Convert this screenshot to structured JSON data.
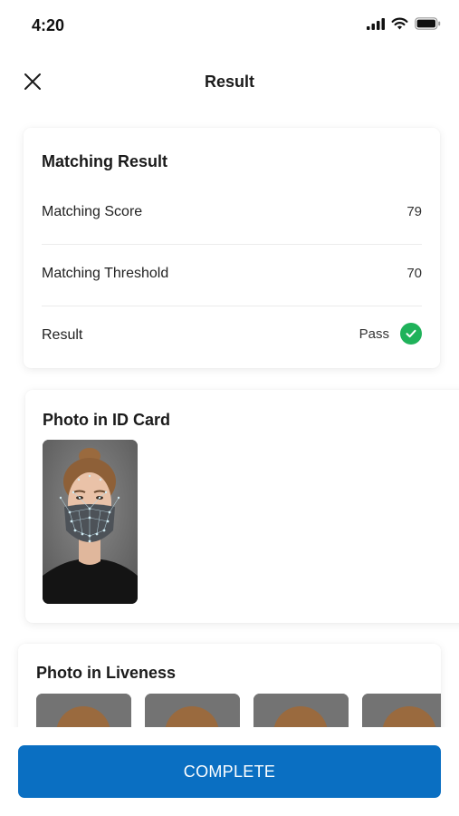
{
  "status_bar": {
    "time": "4:20",
    "icons": [
      "signal-icon",
      "wifi-icon",
      "battery-icon"
    ]
  },
  "header": {
    "title": "Result",
    "close_icon": "close-icon"
  },
  "matching_card": {
    "title": "Matching Result",
    "rows": [
      {
        "label": "Matching Score",
        "value": "79"
      },
      {
        "label": "Matching Threshold",
        "value": "70"
      },
      {
        "label": "Result",
        "value": "Pass",
        "status_icon": "check-circle-icon"
      }
    ]
  },
  "id_card": {
    "title": "Photo in ID Card"
  },
  "liveness_card": {
    "title": "Photo in Liveness",
    "thumbnail_count": 4
  },
  "footer": {
    "complete_label": "COMPLETE"
  },
  "colors": {
    "accent": "#0a6fc2",
    "success": "#1fb25a",
    "text": "#1d1d1f",
    "divider": "#ececec"
  }
}
